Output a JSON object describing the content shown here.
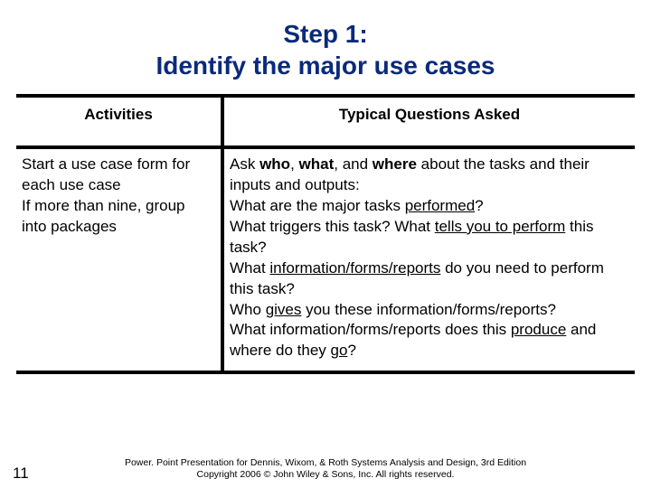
{
  "title_line1": "Step 1:",
  "title_line2": "Identify the major use cases",
  "headers": {
    "activities": "Activities",
    "questions": "Typical Questions Asked"
  },
  "activities": {
    "line1": "Start a use case form for each use case",
    "line2": "If more than nine, group into packages"
  },
  "questions": {
    "intro_pre": "Ask ",
    "intro_who": "who",
    "intro_sep1": ", ",
    "intro_what": "what",
    "intro_sep2": ", and ",
    "intro_where": "where",
    "intro_post": " about the tasks and their inputs and outputs:",
    "q1_pre": "What are the major tasks ",
    "q1_u": "performed",
    "q1_post": "?",
    "q2_pre": "What triggers this task?  What ",
    "q2_u": "tells you to perform",
    "q2_post": " this task?",
    "q3_pre": "What ",
    "q3_u": "information/forms/reports",
    "q3_post": " do you need to perform this task?",
    "q4_pre": "Who ",
    "q4_u": "gives",
    "q4_post": " you these information/forms/reports?",
    "q5_pre": "What information/forms/reports does this ",
    "q5_u1": "produce",
    "q5_mid": " and where do they ",
    "q5_u2": "go",
    "q5_post": "?"
  },
  "footer": {
    "line1": "Power. Point Presentation for Dennis, Wixom, & Roth Systems Analysis and Design, 3rd Edition",
    "line2": "Copyright 2006 © John Wiley & Sons, Inc.  All rights reserved."
  },
  "page_number": "11"
}
